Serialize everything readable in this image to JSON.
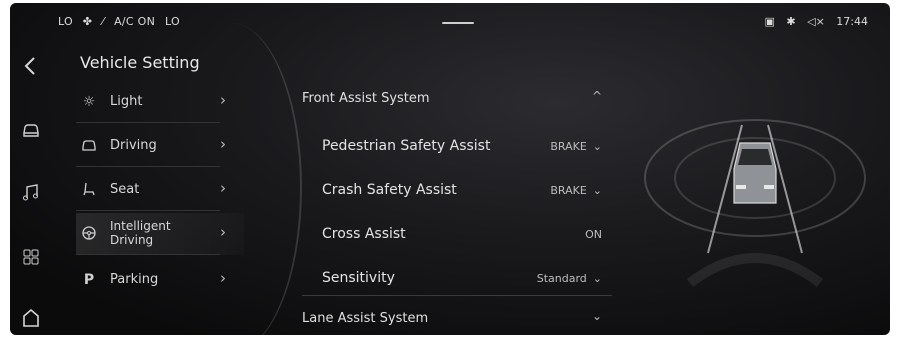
{
  "status_bar": {
    "left_temp": "LO",
    "fan_icon": "fan-icon",
    "ac_label": "A/C ON",
    "right_temp": "LO",
    "time": "17:44",
    "icons": [
      "phone-icon",
      "bluetooth-icon",
      "mute-icon"
    ]
  },
  "nav_rail": {
    "items": [
      "back-icon",
      "car-icon",
      "music-icon",
      "apps-icon",
      "home-icon"
    ]
  },
  "menu": {
    "title": "Vehicle Setting",
    "items": [
      {
        "label": "Light",
        "icon": "sun-icon"
      },
      {
        "label": "Driving",
        "icon": "car-front-icon"
      },
      {
        "label": "Seat",
        "icon": "seat-icon"
      },
      {
        "label": "Intelligent Driving",
        "icon": "steering-wheel-icon",
        "active": true
      },
      {
        "label": "Parking",
        "icon": "parking-icon"
      }
    ]
  },
  "settings": {
    "sections": [
      {
        "title": "Front Assist System",
        "expanded": true,
        "rows": [
          {
            "label": "Pedestrian Safety Assist",
            "value": "BRAKE"
          },
          {
            "label": "Crash Safety Assist",
            "value": "BRAKE"
          },
          {
            "label": "Cross Assist",
            "value": "ON"
          },
          {
            "label": "Sensitivity",
            "value": "Standard"
          }
        ]
      },
      {
        "title": "Lane Assist System",
        "expanded": false
      }
    ]
  }
}
